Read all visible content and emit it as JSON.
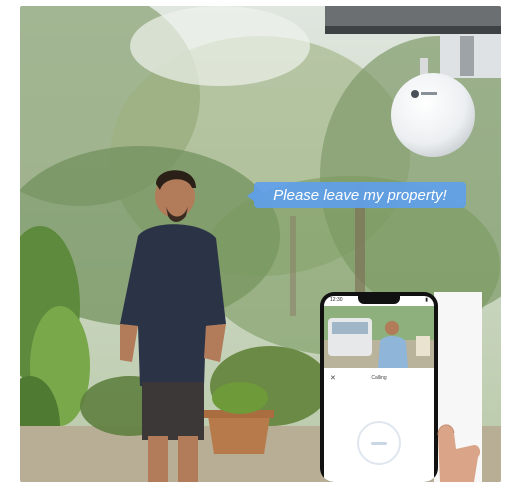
{
  "scene": {
    "speech_bubble": "Please leave my property!",
    "device": "round-white-security-camera"
  },
  "phone_app": {
    "status_time": "12:30",
    "call_title": "Calling",
    "close_icon": "close-icon",
    "talk_button_icon": "microphone-ring-icon"
  }
}
